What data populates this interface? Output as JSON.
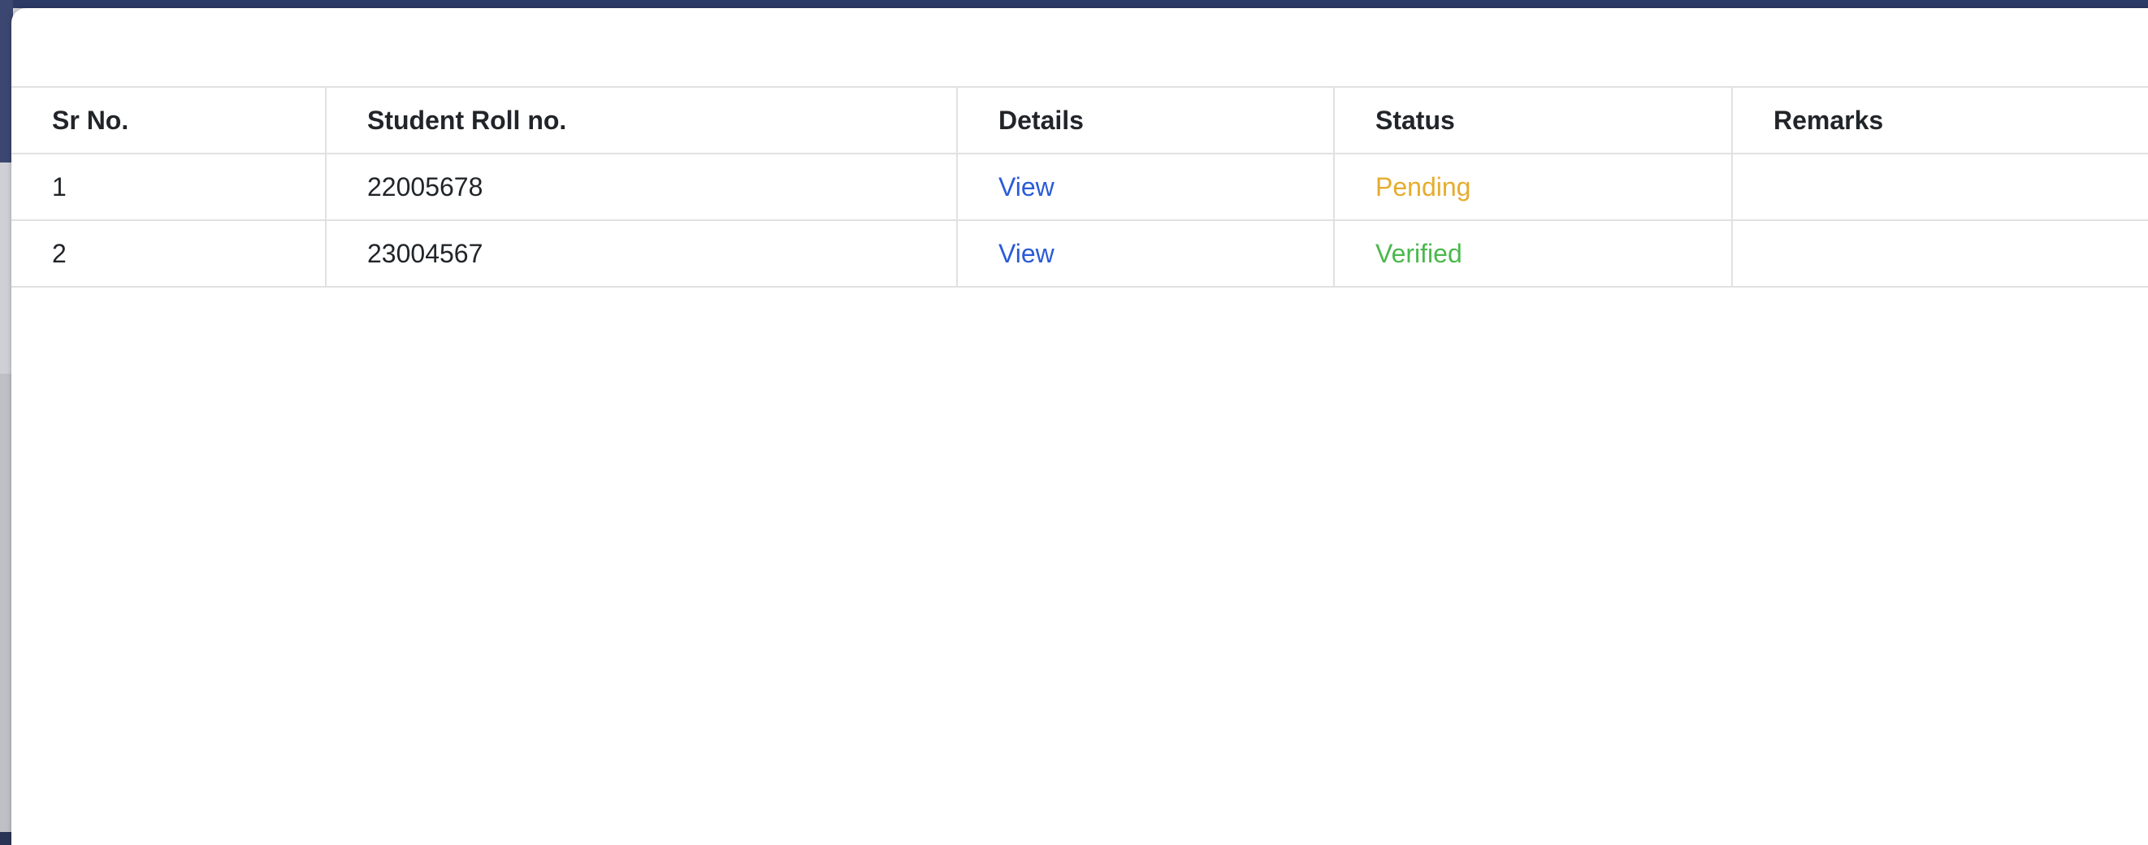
{
  "colors": {
    "link": "#2a5bd7",
    "status_pending": "#e5ac2e",
    "status_verified": "#4cb84e",
    "header_text": "#212529",
    "border": "#e1e1e1"
  },
  "table": {
    "headers": {
      "sr_no": "Sr No.",
      "roll_no": "Student Roll no.",
      "details": "Details",
      "status": "Status",
      "remarks": "Remarks"
    },
    "rows": [
      {
        "sr_no": "1",
        "roll_no": "22005678",
        "details": "View",
        "status": "Pending",
        "remarks": ""
      },
      {
        "sr_no": "2",
        "roll_no": "23004567",
        "details": "View",
        "status": "Verified",
        "remarks": ""
      }
    ]
  }
}
